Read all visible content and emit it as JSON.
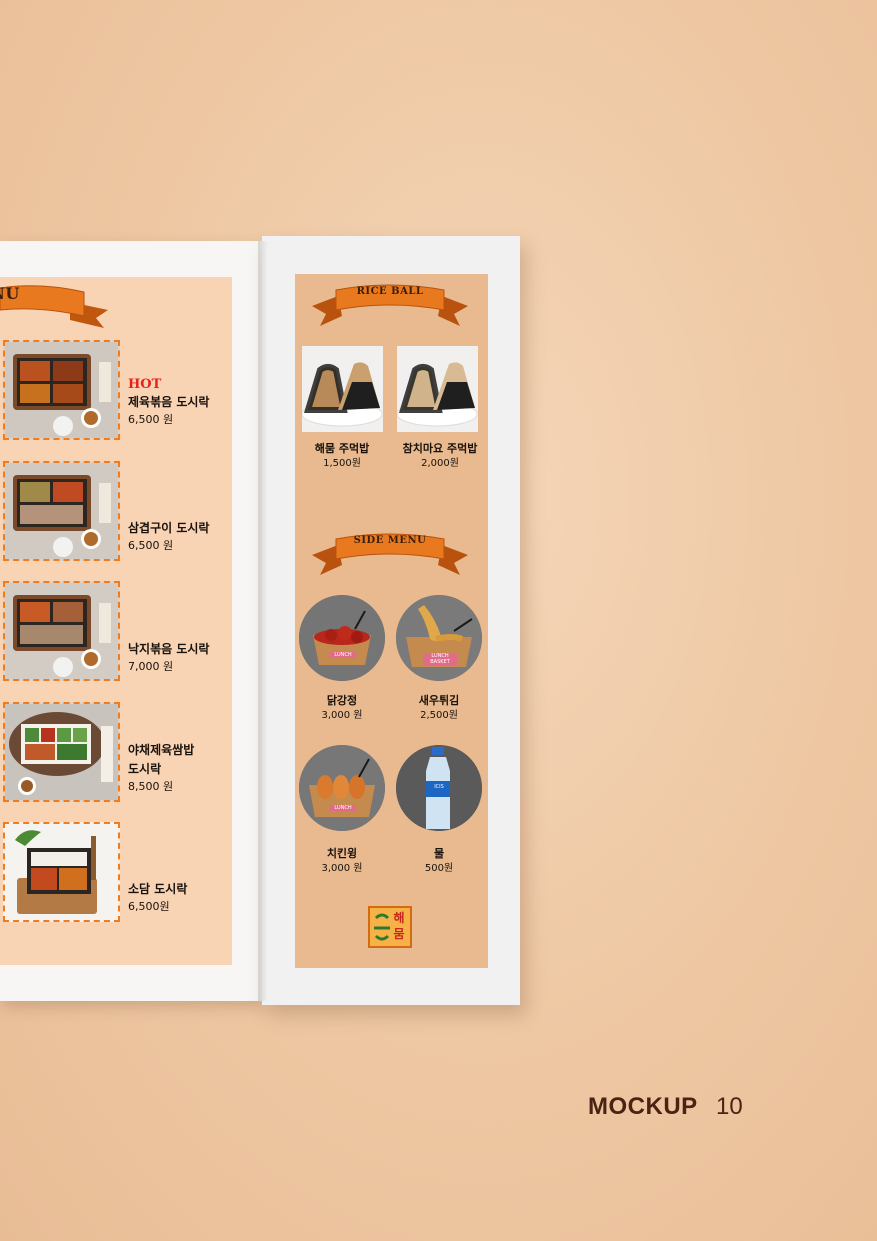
{
  "left_page": {
    "ribbon_text": "NU",
    "items": [
      {
        "badge": "HOT",
        "name": "제육볶음 도시락",
        "price": "6,500 원"
      },
      {
        "name": "삼겹구이 도시락",
        "price": "6,500 원"
      },
      {
        "name": "낙지볶음 도시락",
        "price": "7,000 원"
      },
      {
        "name": "야채제육쌈밥",
        "name2": "도시락",
        "price": "8,500 원"
      },
      {
        "name": "소담 도시락",
        "price": "6,500원"
      }
    ]
  },
  "right_page": {
    "rice_ball_title": "RICE BALL",
    "rice_balls": [
      {
        "name": "해뭄 주먹밥",
        "price": "1,500원"
      },
      {
        "name": "참치마요 주먹밥",
        "price": "2,000원"
      }
    ],
    "side_menu_title": "SIDE MENU",
    "sides": [
      {
        "name": "닭강정",
        "price": "3,000 원",
        "photo_label": "LUNCH"
      },
      {
        "name": "새우튀김",
        "price": "2,500원",
        "photo_label": "LUNCH BASKET"
      },
      {
        "name": "치킨윙",
        "price": "3,000 원",
        "photo_label": "LUNCH"
      },
      {
        "name": "물",
        "price": "500원",
        "photo_label": "ICIS"
      }
    ],
    "logo_text": "해뭄"
  },
  "footer": {
    "label": "MOCKUP",
    "page": "10"
  }
}
